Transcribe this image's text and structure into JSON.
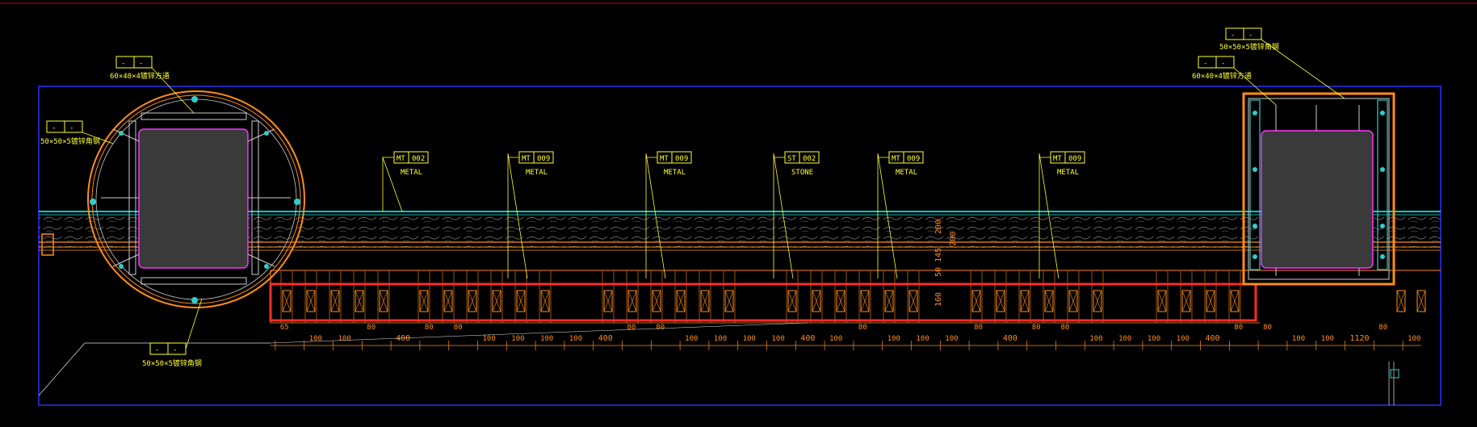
{
  "colors": {
    "background": "#000000",
    "frame": "#2f2fff",
    "leader": "#ffff33",
    "tag": "#ffff33",
    "wall_hatch": "#aaaaaa",
    "wall_top": "#00cccc",
    "orange": "#ff8c1a",
    "highlight": "#ff2a2a",
    "column_fill": "#3a3a3a",
    "column_edge": "#ff33ff",
    "cyan_dot": "#33cccc",
    "top_line": "#cc0000"
  },
  "tags": [
    {
      "code": "MT",
      "num": "002",
      "material": "METAL"
    },
    {
      "code": "MT",
      "num": "009",
      "material": "METAL"
    },
    {
      "code": "MT",
      "num": "009",
      "material": "METAL"
    },
    {
      "code": "ST",
      "num": "002",
      "material": "STONE"
    },
    {
      "code": "MT",
      "num": "009",
      "material": "METAL"
    },
    {
      "code": "MT",
      "num": "009",
      "material": "METAL"
    }
  ],
  "callouts": [
    {
      "label": "60×40×4镀锌方通",
      "box": [
        "-",
        "-"
      ]
    },
    {
      "label": "50×50×5镀锌角钢",
      "box": [
        "-",
        "-"
      ]
    },
    {
      "label": "50×50×5镀锌角钢",
      "box": [
        "-",
        "-"
      ]
    },
    {
      "label": "50×50×5镀锌角钢",
      "box": [
        "-",
        "-"
      ]
    },
    {
      "label": "60×40×4镀锌方通",
      "box": [
        "-",
        "-"
      ]
    }
  ],
  "bottom_dims": [
    "65",
    "100",
    "100",
    "80",
    "400",
    "80",
    "80",
    "100",
    "100",
    "100",
    "100",
    "400",
    "80",
    "80",
    "100",
    "100",
    "100",
    "100",
    "400",
    "100",
    "80",
    "100",
    "100",
    "100",
    "80",
    "400",
    "80",
    "80",
    "100",
    "100",
    "100",
    "100",
    "400",
    "80",
    "80",
    "100",
    "100",
    "1120",
    "80",
    "100"
  ],
  "vertical_dims": [
    "200",
    "145",
    "50",
    "200",
    "160"
  ]
}
